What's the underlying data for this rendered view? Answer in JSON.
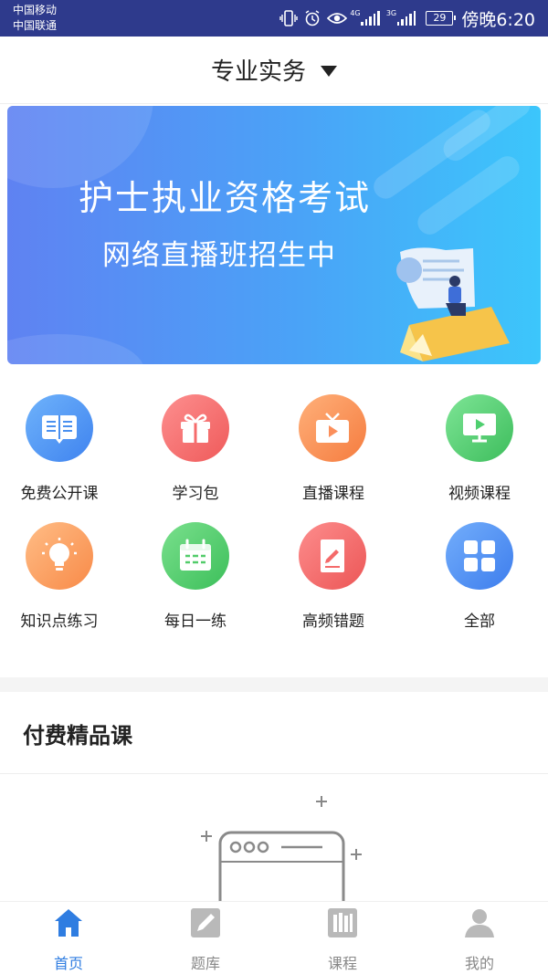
{
  "status_bar": {
    "carrier_1": "中国移动",
    "carrier_2": "中国联通",
    "net_1": "4G",
    "net_2": "3G",
    "battery": "29",
    "time": "傍晚6:20"
  },
  "header": {
    "title": "专业实务"
  },
  "banner": {
    "line1": "护士执业资格考试",
    "line2": "网络直播班招生中"
  },
  "grid": [
    {
      "label": "免费公开课",
      "icon": "open-book-icon",
      "color": "#4a90f0"
    },
    {
      "label": "学习包",
      "icon": "gift-icon",
      "color": "#f56b6b"
    },
    {
      "label": "直播课程",
      "icon": "tv-live-icon",
      "color": "#fb8f5b"
    },
    {
      "label": "视频课程",
      "icon": "video-monitor-icon",
      "color": "#4fcf6f"
    },
    {
      "label": "知识点练习",
      "icon": "lightbulb-icon",
      "color": "#fc9a5a"
    },
    {
      "label": "每日一练",
      "icon": "calendar-icon",
      "color": "#52cc6a"
    },
    {
      "label": "高频错题",
      "icon": "edit-book-icon",
      "color": "#f46a6a"
    },
    {
      "label": "全部",
      "icon": "grid-four-icon",
      "color": "#4a8ef2"
    }
  ],
  "section": {
    "title": "付费精品课"
  },
  "tabbar": {
    "active_color": "#2f7de1",
    "items": [
      {
        "label": "首页",
        "icon": "home-icon",
        "active": true
      },
      {
        "label": "题库",
        "icon": "pencil-icon",
        "active": false
      },
      {
        "label": "课程",
        "icon": "books-icon",
        "active": false
      },
      {
        "label": "我的",
        "icon": "user-icon",
        "active": false
      }
    ]
  }
}
